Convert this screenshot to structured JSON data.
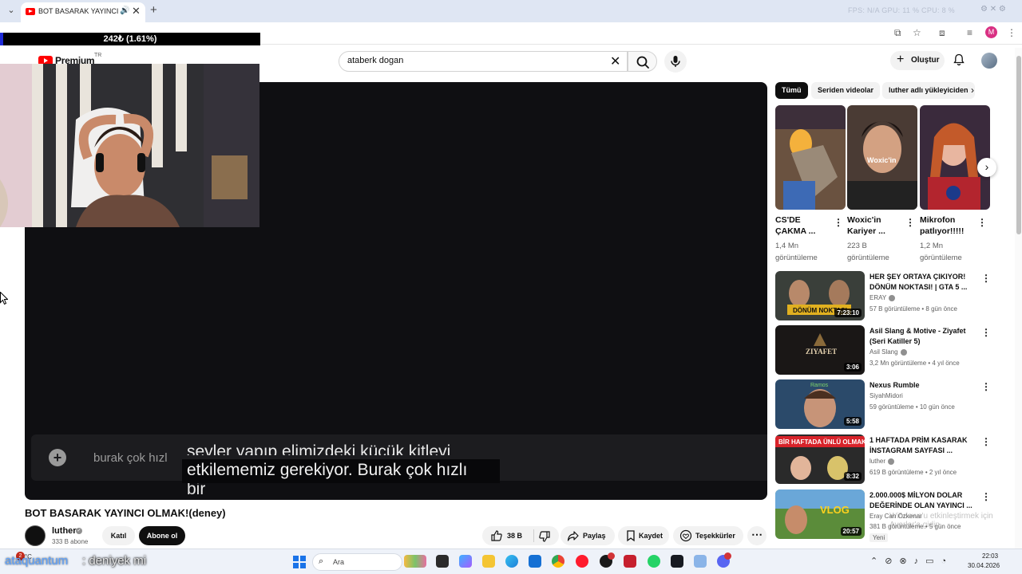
{
  "browser": {
    "tab_title": "BOT BASARAK YAYINCI OL",
    "perf_overlay": "FPS: N/A   GPU: 11 %   CPU: 8 %",
    "profile_initial": "M"
  },
  "stream_overlay": {
    "goal_text": "242₺ (1.61%)",
    "chat_user": "ataquantum",
    "chat_message": ": deniyek mi"
  },
  "youtube": {
    "logo_text": "Premium",
    "logo_region": "TR",
    "search": {
      "value": "ataberk dogan"
    },
    "create_label": "Oluştur"
  },
  "player": {
    "chat_input_text": "burak çok hızl",
    "subtitle_line1": "şeyler yapıp elimizdeki küçük kitleyi",
    "subtitle_line2": "etkilememiz gerekiyor. Burak çok hızlı",
    "subtitle_line3": "bir"
  },
  "video": {
    "title": "BOT BASARAK YAYINCI OLMAK!(deney)",
    "channel": "luther",
    "subscribers": "333 B abone",
    "join_label": "Katıl",
    "subscribe_label": "Abone ol",
    "likes": "38 B",
    "share_label": "Paylaş",
    "save_label": "Kaydet",
    "thanks_label": "Teşekkürler"
  },
  "chips": [
    "Tümü",
    "Seriden videolar",
    "luther adlı yükleyiciden"
  ],
  "shorts": [
    {
      "title": "CS'DE ÇAKMA ...",
      "views": "1,4 Mn görüntüleme",
      "color": "#7a5b3c"
    },
    {
      "title": "Woxic'in Kariyer ...",
      "views": "223 B görüntüleme",
      "color": "#4a3b34"
    },
    {
      "title": "Mikrofon patlıyor!!!!!",
      "views": "1,2 Mn görüntüleme",
      "color": "#5b2a3c"
    }
  ],
  "recommendations": [
    {
      "title": "HER ŞEY ORTAYA ÇIKIYOR! DÖNÜM NOKTASI! | GTA 5 ...",
      "channel": "ERAY",
      "verified": true,
      "meta": "57 B görüntüleme • 8 gün önce",
      "duration": "7:23:10",
      "thumb_text": "DÖNÜM NOKTASI",
      "color": "#3a3f3a"
    },
    {
      "title": "Asil Slang & Motive - Ziyafet (Seri Katiller 5)",
      "channel": "Asil Slang",
      "verified": true,
      "meta": "3,2 Mn görüntüleme • 4 yıl önce",
      "duration": "3:06",
      "thumb_text": "ZIYAFET",
      "color": "#1a1716"
    },
    {
      "title": "Nexus Rumble",
      "channel": "SiyahMidori",
      "verified": false,
      "meta": "59 görüntüleme • 10 gün önce",
      "duration": "5:58",
      "thumb_text": "Ramos",
      "color": "#2b4a6a"
    },
    {
      "title": "1 HAFTADA PRİM KASARAK İNSTAGRAM SAYFASI ...",
      "channel": "luther",
      "verified": true,
      "meta": "619 B görüntüleme • 2 yıl önce",
      "duration": "8:32",
      "thumb_text": "BİR HAFTADA ÜNLÜ OLMAK",
      "color": "#2a2a2a"
    },
    {
      "title": "2.000.000$ MİLYON DOLAR DEĞERİNDE OLAN YAYINCI ...",
      "channel": "Eray Can Özkenar",
      "verified": false,
      "meta": "381 B görüntüleme • 5 gün önce",
      "duration": "20:57",
      "badge": "Yeni",
      "thumb_text": "VLOG",
      "color": "#5b8c3a"
    }
  ],
  "watermark": "Windows'u etkinleştirmek için Ayarlar'a gidin.",
  "taskbar": {
    "weather": "16°C",
    "weather_badge": "2",
    "search_placeholder": "Ara",
    "time": "22:03",
    "date": "30.04.2026"
  }
}
